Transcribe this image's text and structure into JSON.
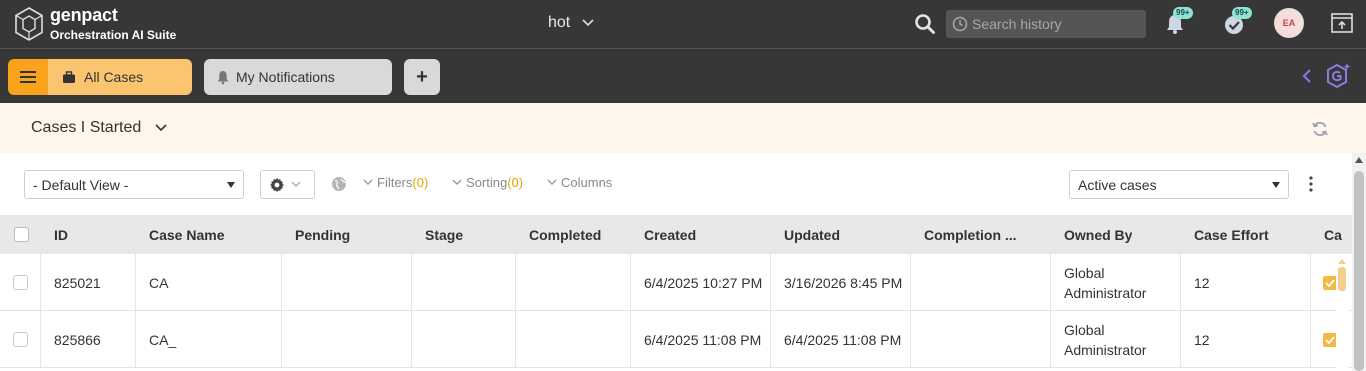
{
  "colors": {
    "accent": "#f9a21b",
    "accent_light": "#fbc56f",
    "header_bg": "#373737",
    "badge": "#8ee4d6",
    "page_header_bg": "#fff6ec",
    "count": "#e8a400"
  },
  "brand": {
    "name": "genpact",
    "subtitle": "Orchestration AI Suite"
  },
  "workspace": {
    "label": "hot"
  },
  "search": {
    "placeholder": "Search history"
  },
  "notifications": {
    "bell_badge": "99+",
    "tasks_badge": "99+"
  },
  "user": {
    "initials": "EA"
  },
  "tabs": {
    "all_cases": "All Cases",
    "my_notifications": "My Notifications",
    "add": "+"
  },
  "page": {
    "title": "Cases I Started"
  },
  "filters": {
    "view": "- Default View -",
    "filters_label": "Filters",
    "filters_count": "(0)",
    "sorting_label": "Sorting",
    "sorting_count": "(0)",
    "columns_label": "Columns",
    "status": "Active cases"
  },
  "table": {
    "columns": [
      "ID",
      "Case Name",
      "Pending",
      "Stage",
      "Completed",
      "Created",
      "Updated",
      "Completion ...",
      "Owned By",
      "Case Effort",
      "Ca"
    ],
    "rows": [
      {
        "id": "825021",
        "case_name": "CA",
        "pending": "",
        "stage": "",
        "completed": "",
        "created": "6/4/2025 10:27 PM",
        "updated": "3/16/2026 8:45 PM",
        "completion": "",
        "owned_by": "Global Administrator",
        "case_effort": "12"
      },
      {
        "id": "825866",
        "case_name": "CA_",
        "pending": "",
        "stage": "",
        "completed": "",
        "created": "6/4/2025 11:08 PM",
        "updated": "6/4/2025 11:08 PM",
        "completion": "",
        "owned_by": "Global Administrator",
        "case_effort": "12"
      }
    ]
  }
}
